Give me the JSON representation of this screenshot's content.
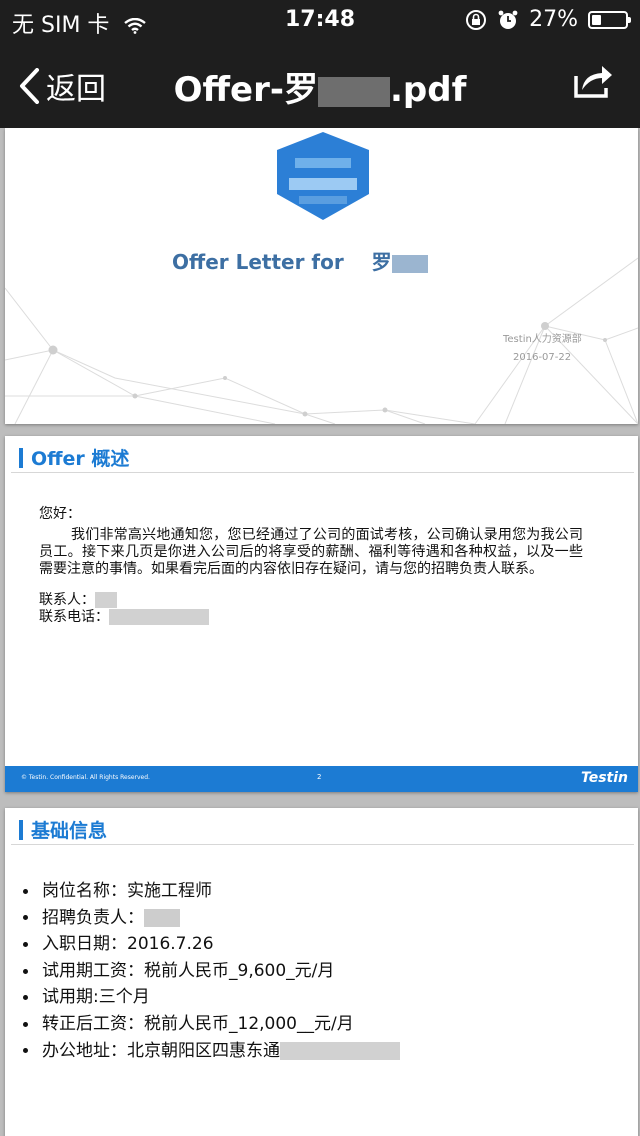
{
  "status_bar": {
    "carrier": "无 SIM 卡",
    "time": "17:48",
    "battery": "27%",
    "battery_level": 0.27
  },
  "nav": {
    "back_label": "返回",
    "title_prefix": "Offer-罗",
    "title_suffix": ".pdf"
  },
  "pages": {
    "cover": {
      "heading_prefix": "Offer Letter for",
      "heading_name": "罗",
      "department": "Testin人力资源部",
      "date": "2016-07-22"
    },
    "overview": {
      "section_title": "Offer 概述",
      "greeting": "您好：",
      "paragraph": "我们非常高兴地通知您，您已经通过了公司的面试考核，公司确认录用您为我公司员工。接下来几页是你进入公司后的将享受的薪酬、福利等待遇和各种权益，以及一些需要注意的事情。如果看完后面的内容依旧存在疑问，请与您的招聘负责人联系。",
      "contact_label": "联系人：",
      "phone_label": "联系电话：",
      "footer_copyright": "© Testin. Confidential. All Rights Reserved.",
      "footer_page": "2",
      "footer_brand": "Testin"
    },
    "basic_info": {
      "section_title": "基础信息",
      "items": [
        "岗位名称：实施工程师",
        "招聘负责人：",
        "入职日期：2016.7.26",
        "试用期工资：税前人民币_9,600_元/月",
        "试用期:三个月",
        "转正后工资：税前人民币_12,000__元/月",
        "办公地址：北京朝阳区四惠东通"
      ]
    }
  },
  "colors": {
    "accent": "#1c7bd3",
    "cover_heading": "#3d6fa3",
    "bar_bg": "#1e1e1e"
  }
}
